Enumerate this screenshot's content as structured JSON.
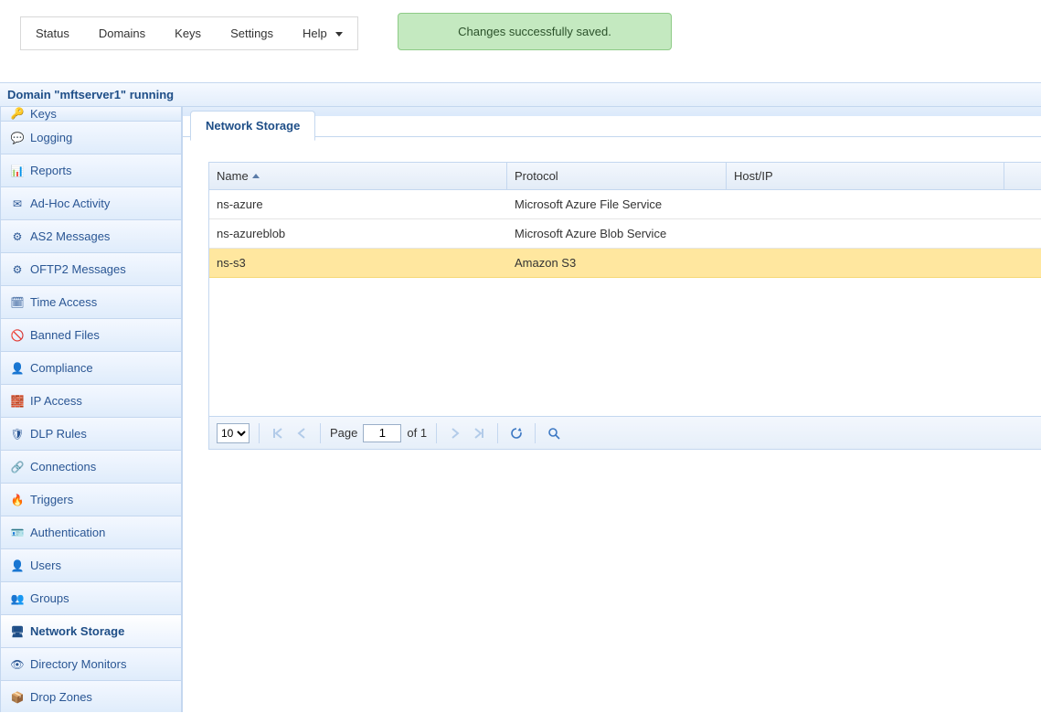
{
  "topnav": {
    "items": [
      "Status",
      "Domains",
      "Keys",
      "Settings",
      "Help"
    ]
  },
  "alert": {
    "text": "Changes successfully saved."
  },
  "domain_bar": "Domain \"mftserver1\" running",
  "sidebar": {
    "items": [
      {
        "label": "Keys",
        "icon": "🔑"
      },
      {
        "label": "Logging",
        "icon": "💬"
      },
      {
        "label": "Reports",
        "icon": "📊"
      },
      {
        "label": "Ad-Hoc Activity",
        "icon": "✉"
      },
      {
        "label": "AS2 Messages",
        "icon": "⚙"
      },
      {
        "label": "OFTP2 Messages",
        "icon": "⚙"
      },
      {
        "label": "Time Access",
        "icon": "🗓"
      },
      {
        "label": "Banned Files",
        "icon": "🚫"
      },
      {
        "label": "Compliance",
        "icon": "👤"
      },
      {
        "label": "IP Access",
        "icon": "🧱"
      },
      {
        "label": "DLP Rules",
        "icon": "🛡"
      },
      {
        "label": "Connections",
        "icon": "🔗"
      },
      {
        "label": "Triggers",
        "icon": "🔥"
      },
      {
        "label": "Authentication",
        "icon": "🪪"
      },
      {
        "label": "Users",
        "icon": "👤"
      },
      {
        "label": "Groups",
        "icon": "👥"
      },
      {
        "label": "Network Storage",
        "icon": "🖥"
      },
      {
        "label": "Directory Monitors",
        "icon": "👁"
      },
      {
        "label": "Drop Zones",
        "icon": "📦"
      }
    ],
    "active_index": 16
  },
  "tab": {
    "label": "Network Storage"
  },
  "grid": {
    "columns": {
      "name": "Name",
      "protocol": "Protocol",
      "host": "Host/IP"
    },
    "sort_column": "name",
    "sort_dir": "asc",
    "rows": [
      {
        "name": "ns-azure",
        "protocol": "Microsoft Azure File Service",
        "host": "",
        "selected": false
      },
      {
        "name": "ns-azureblob",
        "protocol": "Microsoft Azure Blob Service",
        "host": "",
        "selected": false
      },
      {
        "name": "ns-s3",
        "protocol": "Amazon S3",
        "host": "",
        "selected": true
      }
    ]
  },
  "pager": {
    "page_size_options": [
      "10"
    ],
    "page_size": "10",
    "page_label": "Page",
    "current_page": "1",
    "of_label": "of 1"
  }
}
